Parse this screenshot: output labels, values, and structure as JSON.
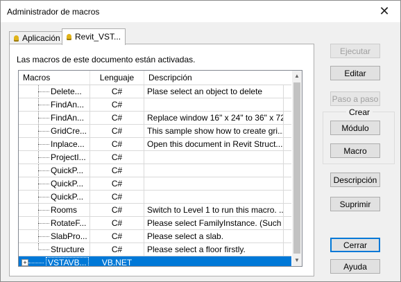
{
  "window": {
    "title": "Administrador de macros",
    "close_glyph": "✕"
  },
  "tabs": [
    {
      "label": "Aplicación",
      "icon": "lightbulb-icon"
    },
    {
      "label": "Revit_VST...",
      "icon": "lightbulb-icon"
    }
  ],
  "panel": {
    "status": "Las macros de este documento están activadas."
  },
  "table": {
    "headers": [
      "Macros",
      "Lenguaje",
      "Descripción"
    ],
    "rows": [
      {
        "name": "Delete...",
        "lang": "C#",
        "desc": "Plase select an object to delete"
      },
      {
        "name": "FindAn...",
        "lang": "C#",
        "desc": ""
      },
      {
        "name": "FindAn...",
        "lang": "C#",
        "desc": "Replace window 16\" x 24\" to 36\" x 72\""
      },
      {
        "name": "GridCre...",
        "lang": "C#",
        "desc": "This sample show how to create gri..."
      },
      {
        "name": "Inplace...",
        "lang": "C#",
        "desc": "Open this document in Revit Struct..."
      },
      {
        "name": "ProjectI...",
        "lang": "C#",
        "desc": ""
      },
      {
        "name": "QuickP...",
        "lang": "C#",
        "desc": ""
      },
      {
        "name": "QuickP...",
        "lang": "C#",
        "desc": ""
      },
      {
        "name": "QuickP...",
        "lang": "C#",
        "desc": ""
      },
      {
        "name": "Rooms",
        "lang": "C#",
        "desc": "Switch to Level 1 to run this macro. ..."
      },
      {
        "name": "RotateF...",
        "lang": "C#",
        "desc": "Please select FamilyInstance. (Such ..."
      },
      {
        "name": "SlabPro...",
        "lang": "C#",
        "desc": "Please select a slab."
      },
      {
        "name": "Structure",
        "lang": "C#",
        "desc": "Please select a floor firstly."
      }
    ],
    "selected_row": {
      "name": "VSTAVB...",
      "lang": "VB.NET",
      "desc": "",
      "expander": "+"
    }
  },
  "buttons": {
    "ejecutar": "Ejecutar",
    "editar": "Editar",
    "paso": "Paso a paso",
    "crear_group": "Crear",
    "modulo": "Módulo",
    "macro": "Macro",
    "descripcion": "Descripción",
    "suprimir": "Suprimir",
    "cerrar": "Cerrar",
    "ayuda": "Ayuda"
  }
}
